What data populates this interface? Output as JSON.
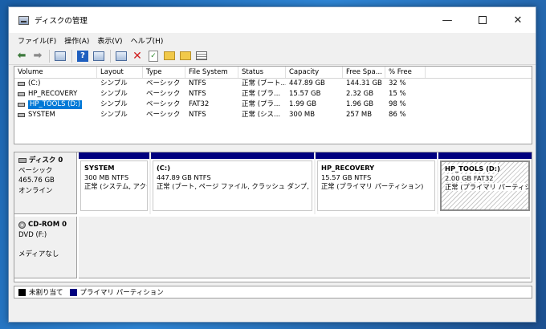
{
  "window": {
    "title": "ディスクの管理"
  },
  "window_controls": {
    "minimize": "—",
    "close": "✕"
  },
  "menubar": [
    "ファイル(F)",
    "操作(A)",
    "表示(V)",
    "ヘルプ(H)"
  ],
  "toolbar": {
    "back": "⬅",
    "forward": "➡",
    "help": "?",
    "delete": "✕",
    "check": "✓"
  },
  "table": {
    "columns": [
      "Volume",
      "Layout",
      "Type",
      "File System",
      "Status",
      "Capacity",
      "Free Spa...",
      "% Free"
    ],
    "rows": [
      {
        "volume": "(C:)",
        "layout": "シンプル",
        "type": "ベーシック",
        "fs": "NTFS",
        "status": "正常 (ブート...",
        "capacity": "447.89 GB",
        "free": "144.31 GB",
        "pct": "32 %"
      },
      {
        "volume": "HP_RECOVERY",
        "layout": "シンプル",
        "type": "ベーシック",
        "fs": "NTFS",
        "status": "正常 (プラ...",
        "capacity": "15.57 GB",
        "free": "2.32 GB",
        "pct": "15 %"
      },
      {
        "volume": "HP_TOOLS (D:)",
        "layout": "シンプル",
        "type": "ベーシック",
        "fs": "FAT32",
        "status": "正常 (プラ...",
        "capacity": "1.99 GB",
        "free": "1.96 GB",
        "pct": "98 %"
      },
      {
        "volume": "SYSTEM",
        "layout": "シンプル",
        "type": "ベーシック",
        "fs": "NTFS",
        "status": "正常 (シス...",
        "capacity": "300 MB",
        "free": "257 MB",
        "pct": "86 %"
      }
    ]
  },
  "disks": [
    {
      "name": "ディスク 0",
      "type": "ベーシック",
      "size": "465.76 GB",
      "status": "オンライン",
      "partitions": [
        {
          "name": "SYSTEM",
          "size": "300 MB NTFS",
          "status": "正常 (システム, アクテ"
        },
        {
          "name": "(C:)",
          "size": "447.89 GB NTFS",
          "status": "正常 (ブート, ページ ファイル, クラッシュ ダンプ, プライマ!"
        },
        {
          "name": "HP_RECOVERY",
          "size": "15.57 GB NTFS",
          "status": "正常 (プライマリ パーティション)"
        },
        {
          "name": "HP_TOOLS  (D:)",
          "size": "2.00 GB FAT32",
          "status": "正常 (プライマリ パーティション)"
        }
      ]
    },
    {
      "name": "CD-ROM 0",
      "type": "DVD (F:)",
      "status": "メディアなし"
    }
  ],
  "legend": [
    {
      "label": "未割り当て",
      "color": "#000000"
    },
    {
      "label": "プライマリ パーティション",
      "color": "#00007f"
    }
  ]
}
